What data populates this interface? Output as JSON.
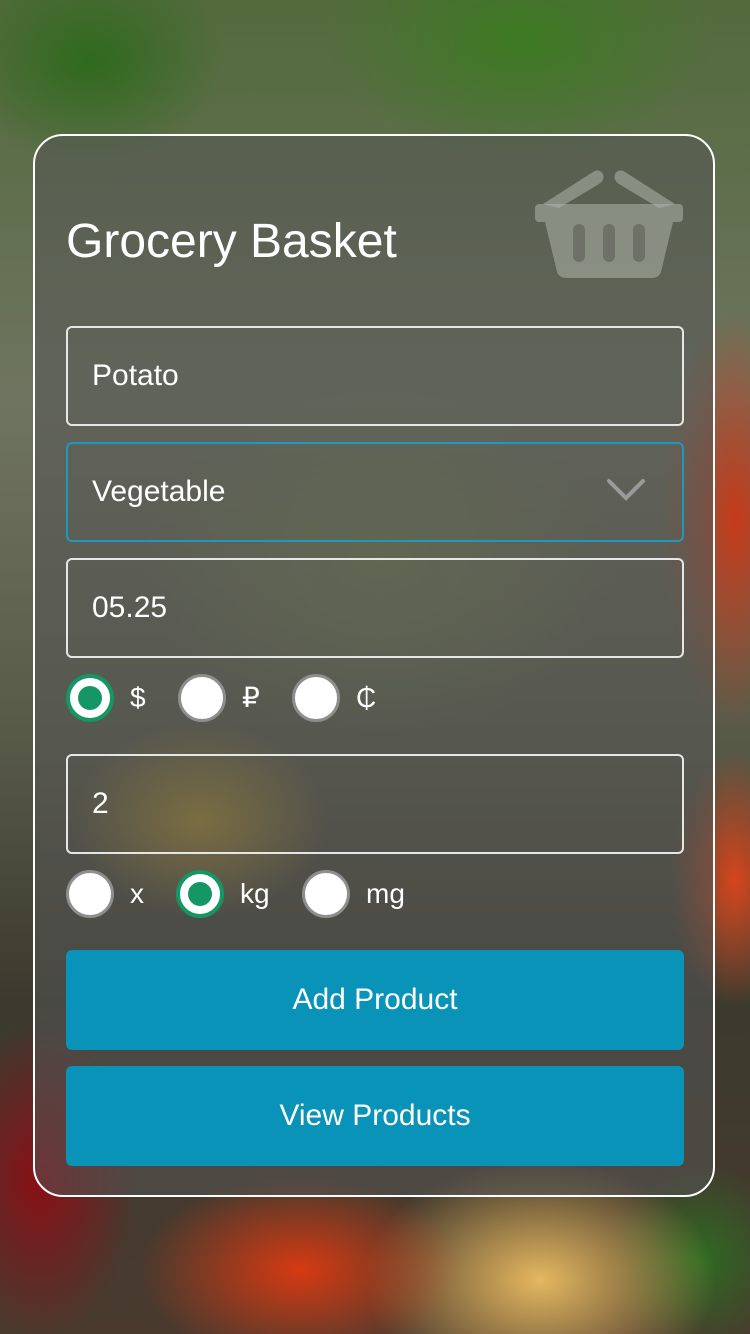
{
  "app": {
    "title": "Grocery Basket",
    "icon": "basket-icon"
  },
  "form": {
    "product_name_value": "Potato",
    "category_value": "Vegetable",
    "price_value": "05.25",
    "quantity_value": "2",
    "currency_options": [
      {
        "label": "$",
        "selected": true
      },
      {
        "label": "₽",
        "selected": false
      },
      {
        "label": "₵",
        "selected": false
      }
    ],
    "unit_options": [
      {
        "label": "x",
        "selected": false
      },
      {
        "label": "kg",
        "selected": true
      },
      {
        "label": "mg",
        "selected": false
      }
    ]
  },
  "buttons": {
    "add_label": "Add Product",
    "view_label": "View Products"
  },
  "colors": {
    "accent": "#0993b8",
    "radio_selected": "#159665",
    "card_border": "#ffffff"
  }
}
